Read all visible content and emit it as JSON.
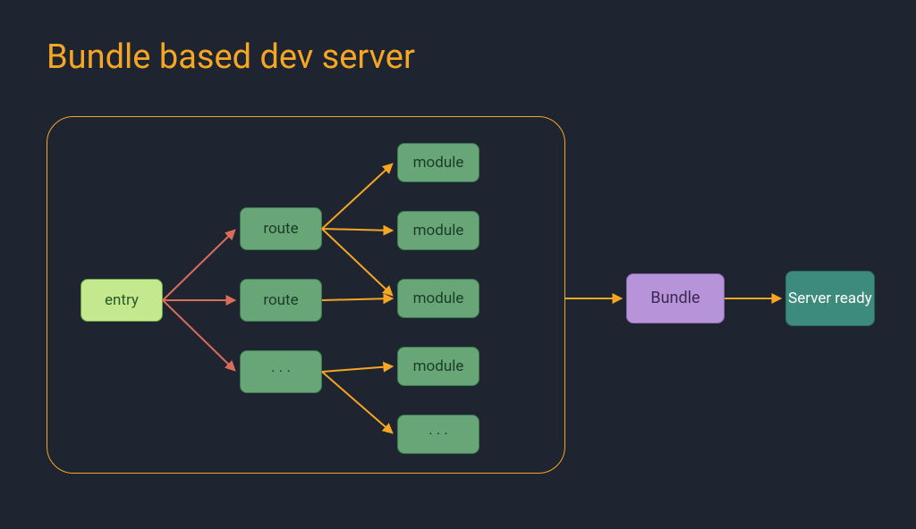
{
  "title": "Bundle based dev server",
  "nodes": {
    "entry": "entry",
    "route1": "route",
    "route2": "route",
    "route3": "· · ·",
    "module1": "module",
    "module2": "module",
    "module3": "module",
    "module4": "module",
    "module5": "· · ·",
    "bundle": "Bundle",
    "ready": "Server ready"
  },
  "colors": {
    "background": "#1e2430",
    "accent": "#f5a623",
    "entry": "#c3e88d",
    "route": "#68a678",
    "bundle": "#b794d9",
    "ready": "#3d8b7d",
    "arrow_red": "#d96c5b",
    "arrow_orange": "#f5a623"
  }
}
